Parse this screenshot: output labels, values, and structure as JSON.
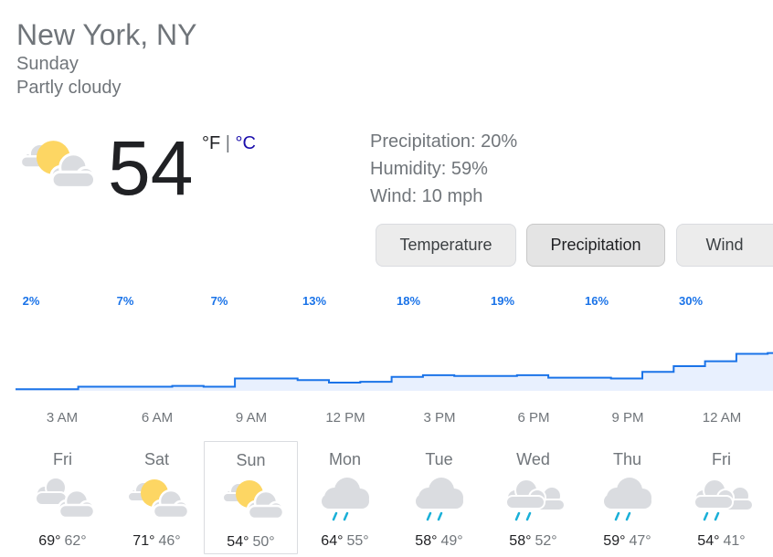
{
  "location": "New York, NY",
  "day": "Sunday",
  "condition": "Partly cloudy",
  "current": {
    "temp": "54",
    "unit_f": "°F",
    "unit_sep": " | ",
    "unit_c": "°C",
    "icon": "partly-cloudy"
  },
  "stats": {
    "precipitation": "Precipitation: 20%",
    "humidity": "Humidity: 59%",
    "wind": "Wind: 10 mph"
  },
  "tabs": {
    "temperature": "Temperature",
    "precipitation": "Precipitation",
    "wind": "Wind",
    "selected": "precipitation"
  },
  "hourly": {
    "labels": [
      "2%",
      "7%",
      "7%",
      "13%",
      "18%",
      "19%",
      "16%",
      "30%"
    ],
    "times": [
      "3 AM",
      "6 AM",
      "9 AM",
      "12 PM",
      "3 PM",
      "6 PM",
      "9 PM",
      "12 AM"
    ],
    "precip_percent": [
      2,
      2,
      5,
      5,
      5,
      6,
      5,
      15,
      15,
      13,
      10,
      11,
      17,
      19,
      18,
      18,
      19,
      16,
      16,
      15,
      23,
      30,
      36,
      45,
      46
    ]
  },
  "daily": [
    {
      "name": "Fri",
      "hi": "69°",
      "lo": "62°",
      "icon": "cloudy",
      "selected": false
    },
    {
      "name": "Sat",
      "hi": "71°",
      "lo": "46°",
      "icon": "partly-cloudy",
      "selected": false
    },
    {
      "name": "Sun",
      "hi": "54°",
      "lo": "50°",
      "icon": "partly-cloudy",
      "selected": true
    },
    {
      "name": "Mon",
      "hi": "64°",
      "lo": "55°",
      "icon": "rain",
      "selected": false
    },
    {
      "name": "Tue",
      "hi": "58°",
      "lo": "49°",
      "icon": "rain",
      "selected": false
    },
    {
      "name": "Wed",
      "hi": "58°",
      "lo": "52°",
      "icon": "showers",
      "selected": false
    },
    {
      "name": "Thu",
      "hi": "59°",
      "lo": "47°",
      "icon": "rain",
      "selected": false
    },
    {
      "name": "Fri",
      "hi": "54°",
      "lo": "41°",
      "icon": "showers",
      "selected": false
    }
  ],
  "colors": {
    "line": "#1a73e8",
    "fill": "#e8f0fe",
    "sun": "#fdd663",
    "cloud": "#dadce0",
    "rain": "#1ab0d8"
  }
}
